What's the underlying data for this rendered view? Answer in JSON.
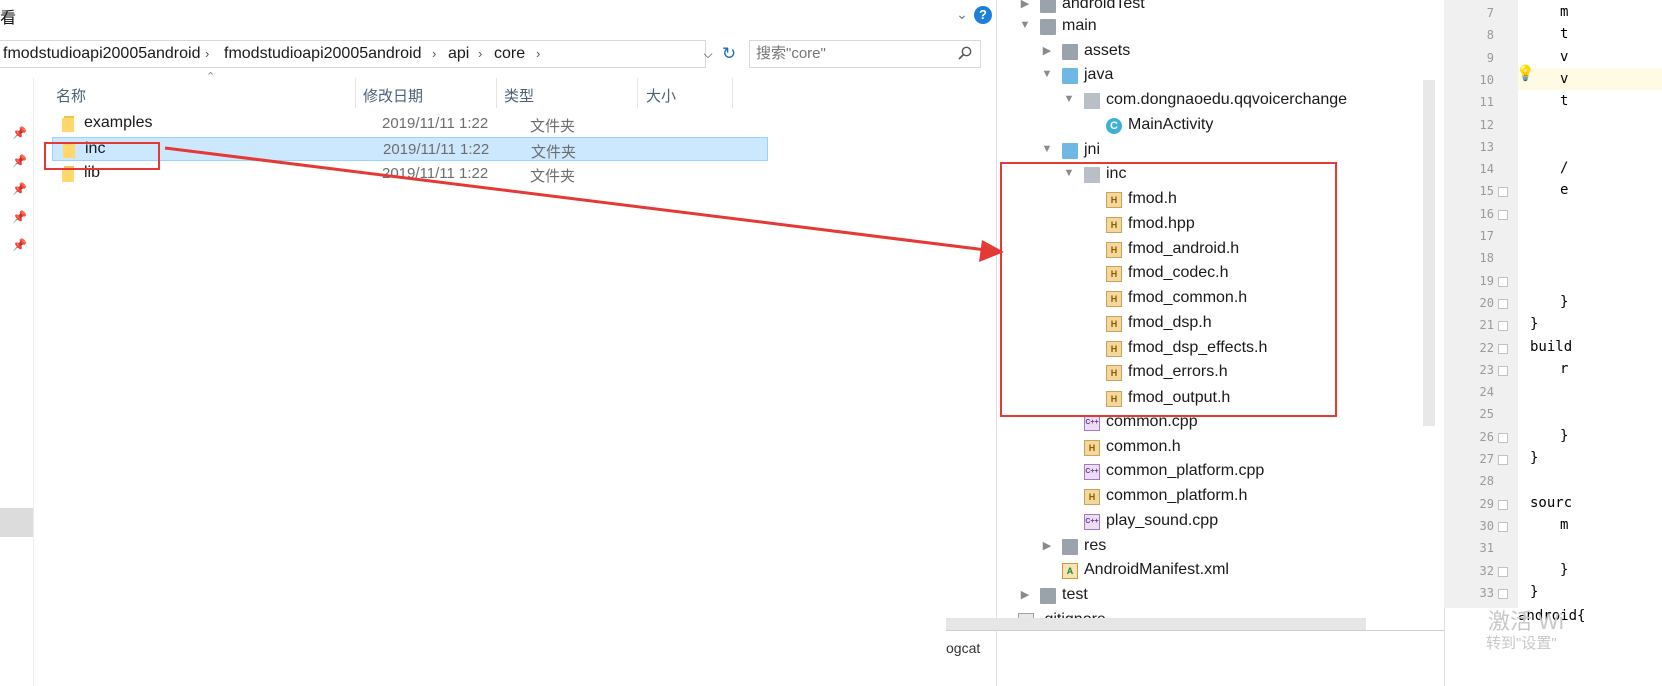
{
  "explorer": {
    "title_fragment": "看",
    "breadcrumbs": [
      "fmodstudioapi20005android",
      "fmodstudioapi20005android",
      "api",
      "core"
    ],
    "search": {
      "placeholder": "搜索\"core\""
    },
    "columns": [
      "名称",
      "修改日期",
      "类型",
      "大小"
    ],
    "files": [
      {
        "name": "examples",
        "modified": "2019/11/11 1:22",
        "type": "文件夹",
        "selected": false
      },
      {
        "name": "inc",
        "modified": "2019/11/11 1:22",
        "type": "文件夹",
        "selected": true
      },
      {
        "name": "lib",
        "modified": "2019/11/11 1:22",
        "type": "文件夹",
        "selected": false
      }
    ]
  },
  "project_tree": {
    "items": [
      {
        "label": "androidTest",
        "icon": "folder-gray-icon"
      },
      {
        "label": "main",
        "icon": "folder-gray-icon"
      },
      {
        "label": "assets",
        "icon": "folder-gray-icon"
      },
      {
        "label": "java",
        "icon": "folder-blue-icon"
      },
      {
        "label": "com.dongnaoedu.qqvoicerchange",
        "icon": "package-icon"
      },
      {
        "label": "MainActivity",
        "icon": "class-icon"
      },
      {
        "label": "jni",
        "icon": "folder-blue-icon"
      },
      {
        "label": "inc",
        "icon": "package-icon"
      },
      {
        "label": "fmod.h",
        "icon": "header-file-icon"
      },
      {
        "label": "fmod.hpp",
        "icon": "header-file-icon"
      },
      {
        "label": "fmod_android.h",
        "icon": "header-file-icon"
      },
      {
        "label": "fmod_codec.h",
        "icon": "header-file-icon"
      },
      {
        "label": "fmod_common.h",
        "icon": "header-file-icon"
      },
      {
        "label": "fmod_dsp.h",
        "icon": "header-file-icon"
      },
      {
        "label": "fmod_dsp_effects.h",
        "icon": "header-file-icon"
      },
      {
        "label": "fmod_errors.h",
        "icon": "header-file-icon"
      },
      {
        "label": "fmod_output.h",
        "icon": "header-file-icon"
      },
      {
        "label": "common.cpp",
        "icon": "cpp-file-icon"
      },
      {
        "label": "common.h",
        "icon": "header-file-icon"
      },
      {
        "label": "common_platform.cpp",
        "icon": "cpp-file-icon"
      },
      {
        "label": "common_platform.h",
        "icon": "header-file-icon"
      },
      {
        "label": "play_sound.cpp",
        "icon": "cpp-file-icon"
      },
      {
        "label": "res",
        "icon": "folder-gray-icon"
      },
      {
        "label": "AndroidManifest.xml",
        "icon": "xml-file-icon"
      },
      {
        "label": "test",
        "icon": "folder-gray-icon"
      },
      {
        "label": ".gitignore",
        "icon": "file-icon"
      }
    ],
    "bottom_tab": "ogcat"
  },
  "editor": {
    "line_numbers": [
      "7",
      "8",
      "9",
      "10",
      "11",
      "12",
      "13",
      "14",
      "15",
      "16",
      "17",
      "18",
      "19",
      "20",
      "21",
      "22",
      "23",
      "24",
      "25",
      "26",
      "27",
      "28",
      "29",
      "30",
      "31",
      "32",
      "33"
    ],
    "code": {
      "l7": "m",
      "l8": "t",
      "l9": "v",
      "l10": "v",
      "l11": "t",
      "l14": "/",
      "l15": "e",
      "l20": "}",
      "l21": "}",
      "l22": "build",
      "l23": "r",
      "l26": "}",
      "l27": "}",
      "l29": "sourc",
      "l30": "m",
      "l32": "}",
      "l33": "}",
      "bottom": "android{"
    },
    "watermark_line1": "激活 Wi",
    "watermark_line2": "转到\"设置\""
  },
  "colors": {
    "highlight_red": "#e53935",
    "selection_blue": "#cce8ff"
  }
}
